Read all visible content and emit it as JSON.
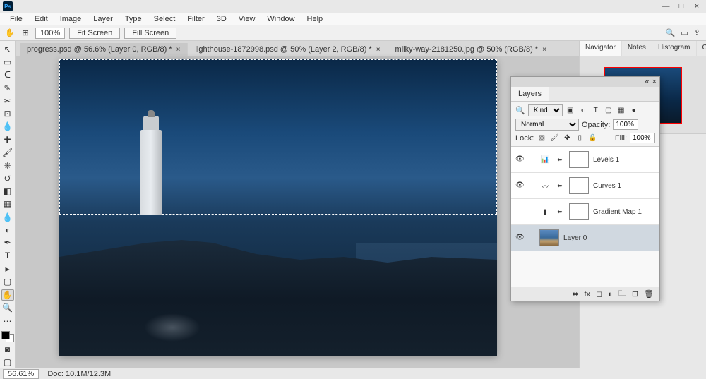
{
  "app": {
    "name": "Ps"
  },
  "window_controls": {
    "min": "—",
    "max": "□",
    "close": "×"
  },
  "menu": [
    "File",
    "Edit",
    "Image",
    "Layer",
    "Type",
    "Select",
    "Filter",
    "3D",
    "View",
    "Window",
    "Help"
  ],
  "options": {
    "zoom": "100%",
    "btn1": "Fit Screen",
    "btn2": "Fill Screen"
  },
  "doc_tabs": [
    {
      "label": "progress.psd @ 56.6% (Layer 0, RGB/8) *",
      "active": true
    },
    {
      "label": "lighthouse-1872998.psd @ 50% (Layer 2, RGB/8) *",
      "active": false
    },
    {
      "label": "milky-way-2181250.jpg @ 50% (RGB/8) *",
      "active": false
    }
  ],
  "top_panels": [
    "Navigator",
    "Notes",
    "Histogram",
    "Color"
  ],
  "layers_panel": {
    "title": "Layers",
    "filter_label": "Kind",
    "blend": "Normal",
    "opacity_label": "Opacity:",
    "opacity": "100%",
    "lock_label": "Lock:",
    "fill_label": "Fill:",
    "fill": "100%",
    "layers": [
      {
        "name": "Levels 1",
        "type": "adj",
        "icon": "📊"
      },
      {
        "name": "Curves 1",
        "type": "adj",
        "icon": "〰"
      },
      {
        "name": "Gradient Map 1",
        "type": "adj",
        "icon": "▮"
      },
      {
        "name": "Layer 0",
        "type": "img",
        "selected": true
      }
    ]
  },
  "status": {
    "zoom": "56.61%",
    "doc": "Doc: 10.1M/12.3M"
  }
}
